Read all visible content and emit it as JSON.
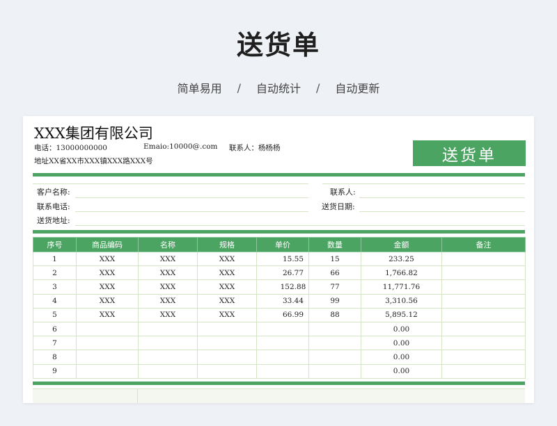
{
  "hero": {
    "title": "送货单",
    "features": [
      "简单易用",
      "自动统计",
      "自动更新"
    ],
    "separator": "/"
  },
  "header": {
    "company": "XXX集团有限公司",
    "phone": "电话：13000000000",
    "email": "Emaio:10000@.com",
    "contact": "联系人：杨杨杨",
    "address": "地址XX省XX市XXX镇XXX路XXX号",
    "badge": "送货单"
  },
  "customer": {
    "name_label": "客户名称:",
    "contact_label": "联系人:",
    "phone_label": "联系电话:",
    "date_label": "送货日期:",
    "address_label": "送货地址:"
  },
  "table": {
    "headers": [
      "序号",
      "商品编码",
      "名称",
      "规格",
      "单价",
      "数量",
      "金额",
      "备注"
    ],
    "rows": [
      [
        "1",
        "XXX",
        "XXX",
        "XXX",
        "15.55",
        "15",
        "233.25",
        ""
      ],
      [
        "2",
        "XXX",
        "XXX",
        "XXX",
        "26.77",
        "66",
        "1,766.82",
        ""
      ],
      [
        "3",
        "XXX",
        "XXX",
        "XXX",
        "152.88",
        "77",
        "11,771.76",
        ""
      ],
      [
        "4",
        "XXX",
        "XXX",
        "XXX",
        "33.44",
        "99",
        "3,310.56",
        ""
      ],
      [
        "5",
        "XXX",
        "XXX",
        "XXX",
        "66.99",
        "88",
        "5,895.12",
        ""
      ],
      [
        "6",
        "",
        "",
        "",
        "",
        "",
        "0.00",
        ""
      ],
      [
        "7",
        "",
        "",
        "",
        "",
        "",
        "0.00",
        ""
      ],
      [
        "8",
        "",
        "",
        "",
        "",
        "",
        "0.00",
        ""
      ],
      [
        "9",
        "",
        "",
        "",
        "",
        "",
        "0.00",
        ""
      ]
    ]
  },
  "colors": {
    "accent": "#4ca463",
    "grid": "#d4e4c4"
  }
}
